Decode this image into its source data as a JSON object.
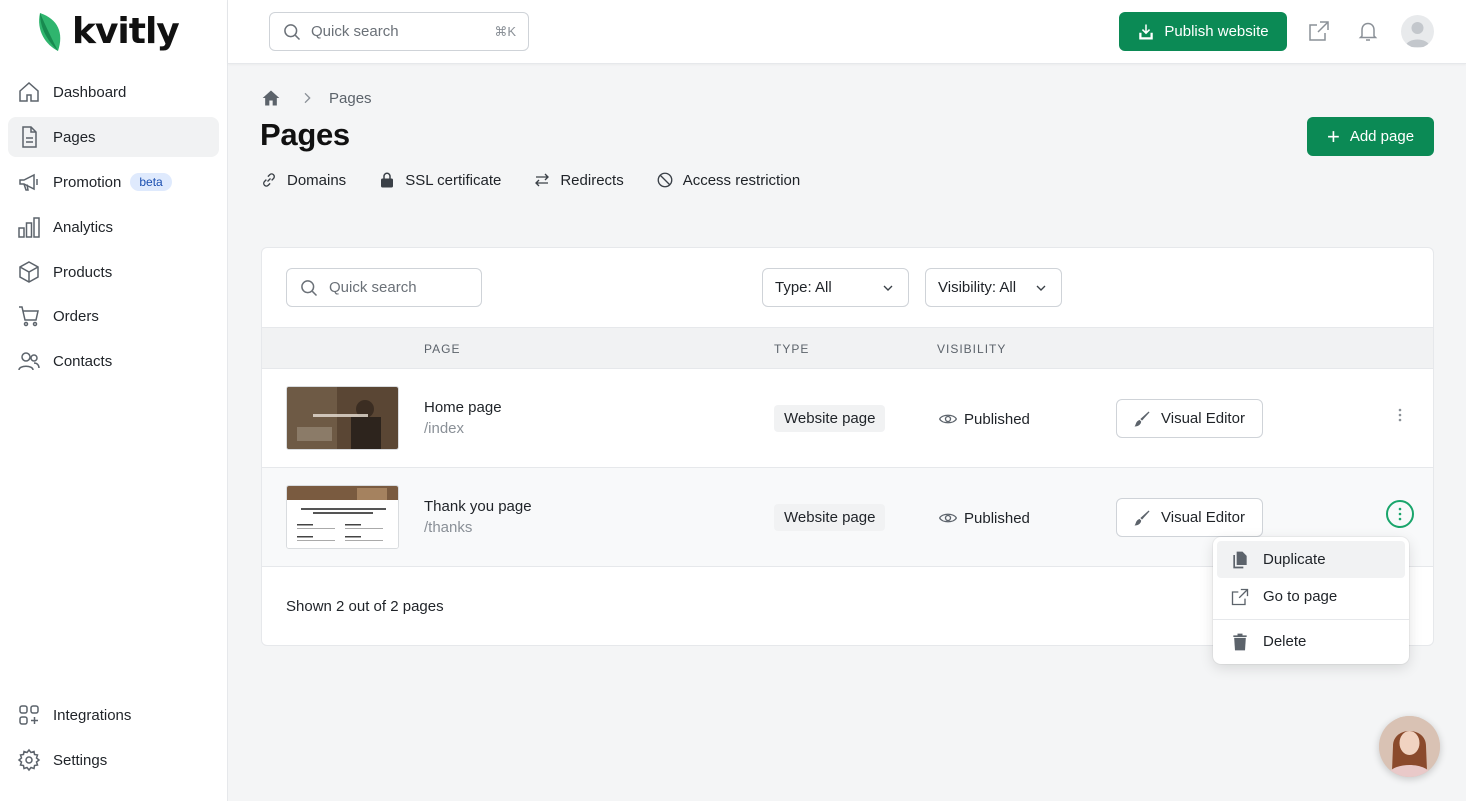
{
  "brand": {
    "name": "kvitly",
    "accent": "#0b8a55"
  },
  "sidebar": {
    "items": [
      {
        "label": "Dashboard",
        "icon": "home-icon"
      },
      {
        "label": "Pages",
        "icon": "document-icon",
        "active": true
      },
      {
        "label": "Promotion",
        "icon": "megaphone-icon",
        "badge": "beta"
      },
      {
        "label": "Analytics",
        "icon": "bar-chart-icon"
      },
      {
        "label": "Products",
        "icon": "box-icon"
      },
      {
        "label": "Orders",
        "icon": "cart-icon"
      },
      {
        "label": "Contacts",
        "icon": "users-icon"
      }
    ],
    "bottom": [
      {
        "label": "Integrations",
        "icon": "grid-plus-icon"
      },
      {
        "label": "Settings",
        "icon": "gear-icon"
      }
    ]
  },
  "topbar": {
    "search_placeholder": "Quick search",
    "search_shortcut": "⌘K",
    "publish_label": "Publish website"
  },
  "breadcrumb": {
    "current": "Pages"
  },
  "page": {
    "title": "Pages",
    "add_label": "Add page"
  },
  "subnav": [
    {
      "label": "Domains",
      "icon": "link-icon"
    },
    {
      "label": "SSL certificate",
      "icon": "lock-icon"
    },
    {
      "label": "Redirects",
      "icon": "arrows-icon"
    },
    {
      "label": "Access restriction",
      "icon": "ban-icon"
    }
  ],
  "filters": {
    "search_placeholder": "Quick search",
    "type": "Type: All",
    "visibility": "Visibility: All"
  },
  "table": {
    "columns": [
      "PAGE",
      "TYPE",
      "VISIBILITY"
    ],
    "rows": [
      {
        "name": "Home page",
        "url": "/index",
        "type": "Website page",
        "visibility": "Published",
        "action": "Visual Editor"
      },
      {
        "name": "Thank you page",
        "url": "/thanks",
        "type": "Website page",
        "visibility": "Published",
        "action": "Visual Editor"
      }
    ],
    "footer": "Shown 2 out of 2 pages"
  },
  "row_menu": {
    "items": [
      {
        "label": "Duplicate",
        "icon": "copy-icon"
      },
      {
        "label": "Go to page",
        "icon": "external-link-icon"
      },
      {
        "label": "Delete",
        "icon": "trash-icon"
      }
    ]
  }
}
